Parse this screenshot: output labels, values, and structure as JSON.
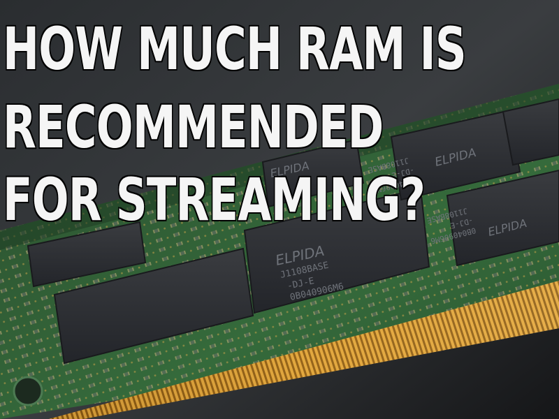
{
  "headline": {
    "lines": [
      "HOW MUCH RAM IS",
      "RECOMMENDED",
      "FOR STREAMING?"
    ]
  },
  "chips": [
    {
      "brand": "ELPIDA",
      "model": "J1108BASE",
      "suffix": "-DJ-E",
      "code": "0B040906M6"
    },
    {
      "brand": "ELPIDA",
      "model": "",
      "suffix": "",
      "code": ""
    },
    {
      "brand": "ELPIDA",
      "model": "J1108BASE",
      "suffix": "-DJ-E",
      "code": "0B040906M6"
    },
    {
      "brand": "ELPIDA",
      "model": "J1108BASE",
      "suffix": "-DJ-E",
      "code": "0B040906M6"
    }
  ],
  "colors": {
    "background": "#1a1c1e",
    "pcb": "#2f5a34",
    "chip": "#2e3033",
    "gold": "#d79a2b",
    "text": "#f5f5f5"
  }
}
